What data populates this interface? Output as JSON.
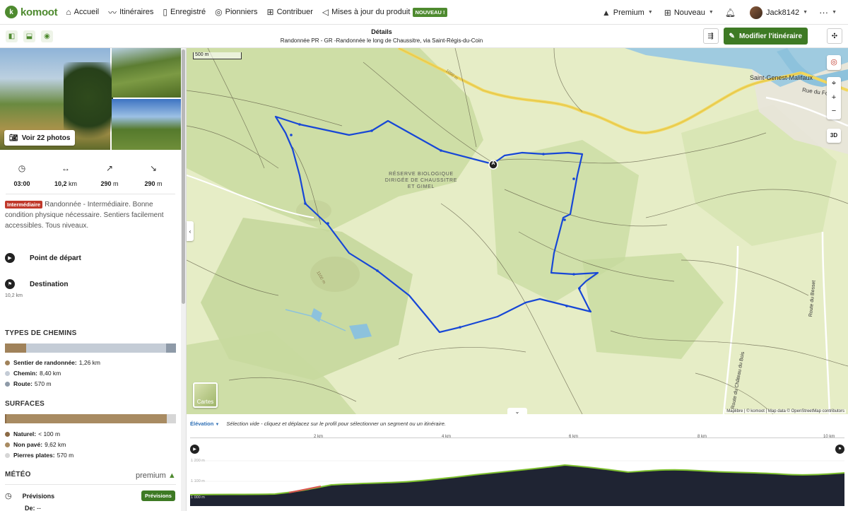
{
  "topbar": {
    "brand": "komoot",
    "nav": [
      {
        "label": "Accueil",
        "icon": "home-icon"
      },
      {
        "label": "Itinéraires",
        "icon": "route-icon"
      },
      {
        "label": "Enregistré",
        "icon": "bookmark-icon"
      },
      {
        "label": "Pionniers",
        "icon": "pioneer-icon"
      },
      {
        "label": "Contribuer",
        "icon": "contribute-icon"
      },
      {
        "label": "Mises à jour du produit",
        "icon": "megaphone-icon"
      }
    ],
    "new_badge": "NOUVEAU !",
    "premium": "Premium",
    "new_menu": "Nouveau",
    "user": "Jack8142"
  },
  "toolbar": {
    "title": "Détails",
    "subtitle": "Randonnée PR - GR -Randonnée le long de Chaussitre, via Saint-Régis-du-Coin",
    "edit_label": "Modifier l'itinéraire"
  },
  "sidebar": {
    "photos_label": "Voir 22 photos",
    "stats": [
      {
        "icon": "stopwatch-icon",
        "glyph": "◷",
        "value": "03:00",
        "unit": ""
      },
      {
        "icon": "distance-icon",
        "glyph": "↔",
        "value": "10,2",
        "unit": "km"
      },
      {
        "icon": "ascent-icon",
        "glyph": "↗",
        "value": "290",
        "unit": "m"
      },
      {
        "icon": "descent-icon",
        "glyph": "↘",
        "value": "290",
        "unit": "m"
      }
    ],
    "difficulty_badge": "Intermédiaire",
    "difficulty_text": "Randonnée - Intermédiaire. Bonne condition physique nécessaire. Sentiers facilement accessibles. Tous niveaux.",
    "start_label": "Point de départ",
    "destination_label": "Destination",
    "destination_distance": "10,2 km",
    "way_types_title": "TYPES DE CHEMINS",
    "way_types": [
      {
        "name": "Sentier de randonnée:",
        "value": "1,26 km",
        "color": "#a0825a",
        "fraction": 0.124
      },
      {
        "name": "Chemin:",
        "value": "8,40 km",
        "color": "#c4ccd6",
        "fraction": 0.82
      },
      {
        "name": "Route:",
        "value": "570 m",
        "color": "#8e9aa8",
        "fraction": 0.056
      }
    ],
    "surfaces_title": "SURFACES",
    "surfaces": [
      {
        "name": "Naturel:",
        "value": "< 100 m",
        "color": "#8b6a45",
        "fraction": 0.01
      },
      {
        "name": "Non pavé:",
        "value": "9,62 km",
        "color": "#a88b62",
        "fraction": 0.935
      },
      {
        "name": "Pierres plates:",
        "value": "570 m",
        "color": "#d6d6d6",
        "fraction": 0.055
      }
    ],
    "weather_title": "MÉTÉO",
    "premium_label": "premium",
    "forecast_label": "Prévisions",
    "forecast_button": "Prévisions",
    "from_label": "De:",
    "from_value": "--"
  },
  "map": {
    "scale_label": "500 m",
    "labels": {
      "reserve": [
        "RÉSERVE BIOLOGIQUE",
        "DIRIGÉE DE CHAUSSITRE",
        "ET GIMEL"
      ],
      "town": "Saint-Genest-Malifaux",
      "road1": "Rue du Forez",
      "road2": "Route du Besset",
      "road3": "Route du Château du Bois",
      "contour1": "1000 m",
      "contour2": "1100 m"
    },
    "start_marker": "A",
    "layers_label": "Cartes",
    "controls": {
      "compass": "compass-icon",
      "locate": "locate-icon",
      "zoom_in": "+",
      "zoom_out": "−",
      "three_d": "3D"
    },
    "attribution": "Maplibre | © komoot | Map data © OpenStreetMap contributors",
    "colors": {
      "route": "#1747d6",
      "terrain": "#e3ebc1",
      "forest": "#c4d79a",
      "water": "#8dc2dc",
      "road_major": "#f2d75c"
    }
  },
  "elevation": {
    "tab_label": "Élévation",
    "hint": "Sélection vide - cliquez et déplacez sur le profil pour sélectionner un segment ou un itinéraire.",
    "km_ticks": [
      "2 km",
      "4 km",
      "6 km",
      "8 km",
      "10 km"
    ],
    "y_ticks": [
      "1 200 m",
      "1 100 m",
      "1 000 m"
    ]
  }
}
